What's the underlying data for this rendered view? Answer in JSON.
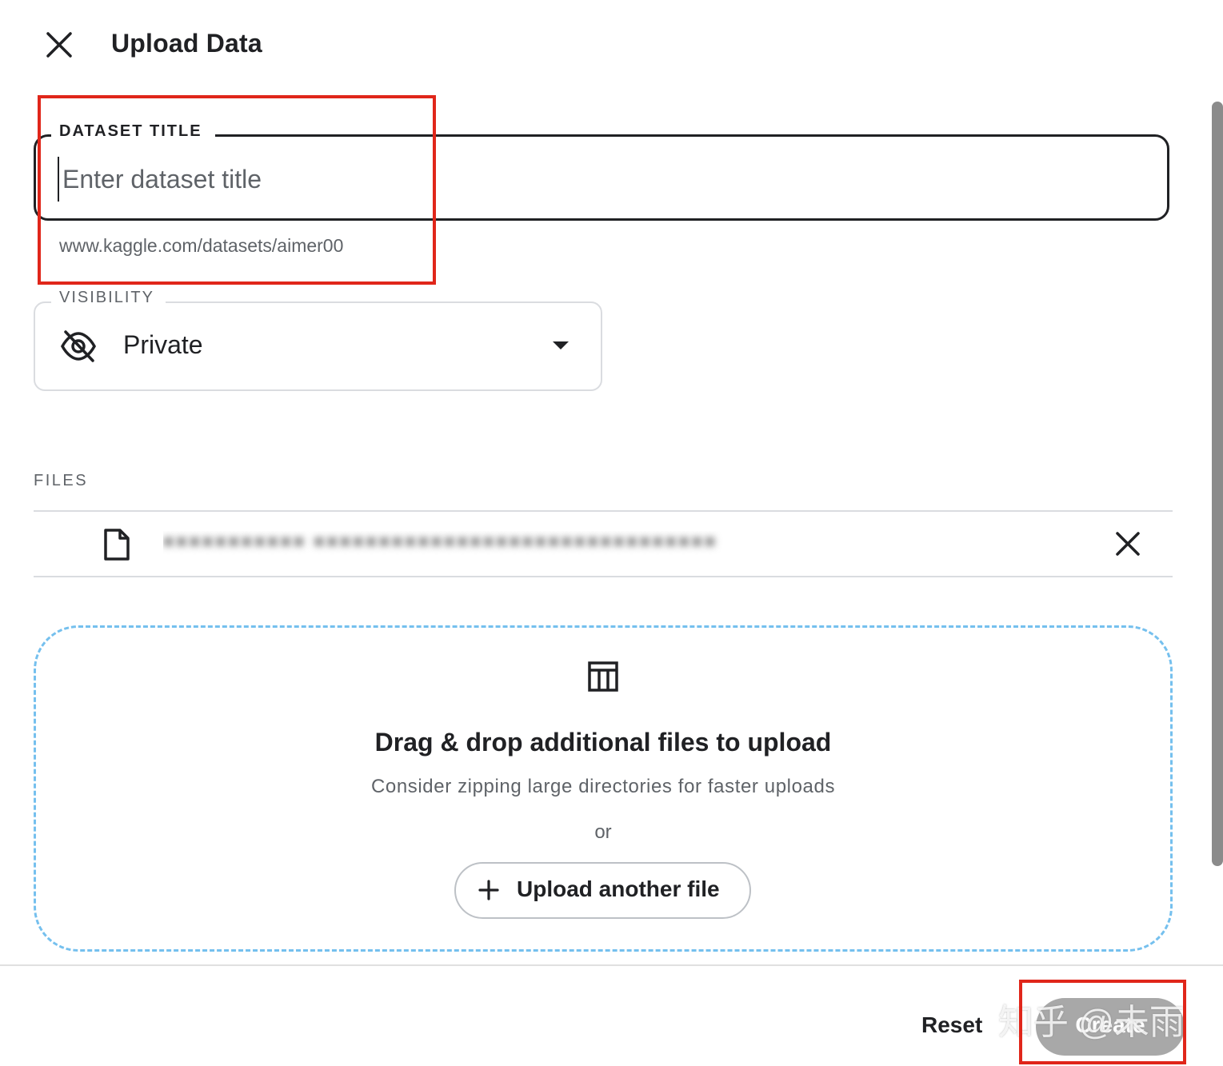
{
  "header": {
    "title": "Upload Data",
    "close_icon": "close-icon"
  },
  "dataset_title": {
    "label": "DATASET TITLE",
    "value": "",
    "placeholder": "Enter dataset title",
    "url_hint": "www.kaggle.com/datasets/aimer00"
  },
  "visibility": {
    "label": "VISIBILITY",
    "selected": "Private",
    "icon": "eye-off-icon",
    "dropdown_icon": "caret-down-icon"
  },
  "files": {
    "label": "FILES",
    "items": [
      {
        "name": "■■■■■■■■■■■ ■■■■■■■■■■■■■■■■■■■■■■■■■■■■■■■",
        "icon": "file-icon",
        "remove_icon": "close-icon"
      }
    ]
  },
  "dropzone": {
    "icon": "table-icon",
    "title": "Drag & drop additional files to upload",
    "subtitle": "Consider zipping large directories for faster uploads",
    "or": "or",
    "upload_button": "Upload another file",
    "upload_icon": "plus-icon",
    "border_color": "#75c0ee"
  },
  "footer": {
    "reset_label": "Reset",
    "create_label": "Create",
    "create_bg": "#a8a8a8"
  },
  "annotations": {
    "color": "#e0261a"
  },
  "watermark": "知乎 @未雨"
}
